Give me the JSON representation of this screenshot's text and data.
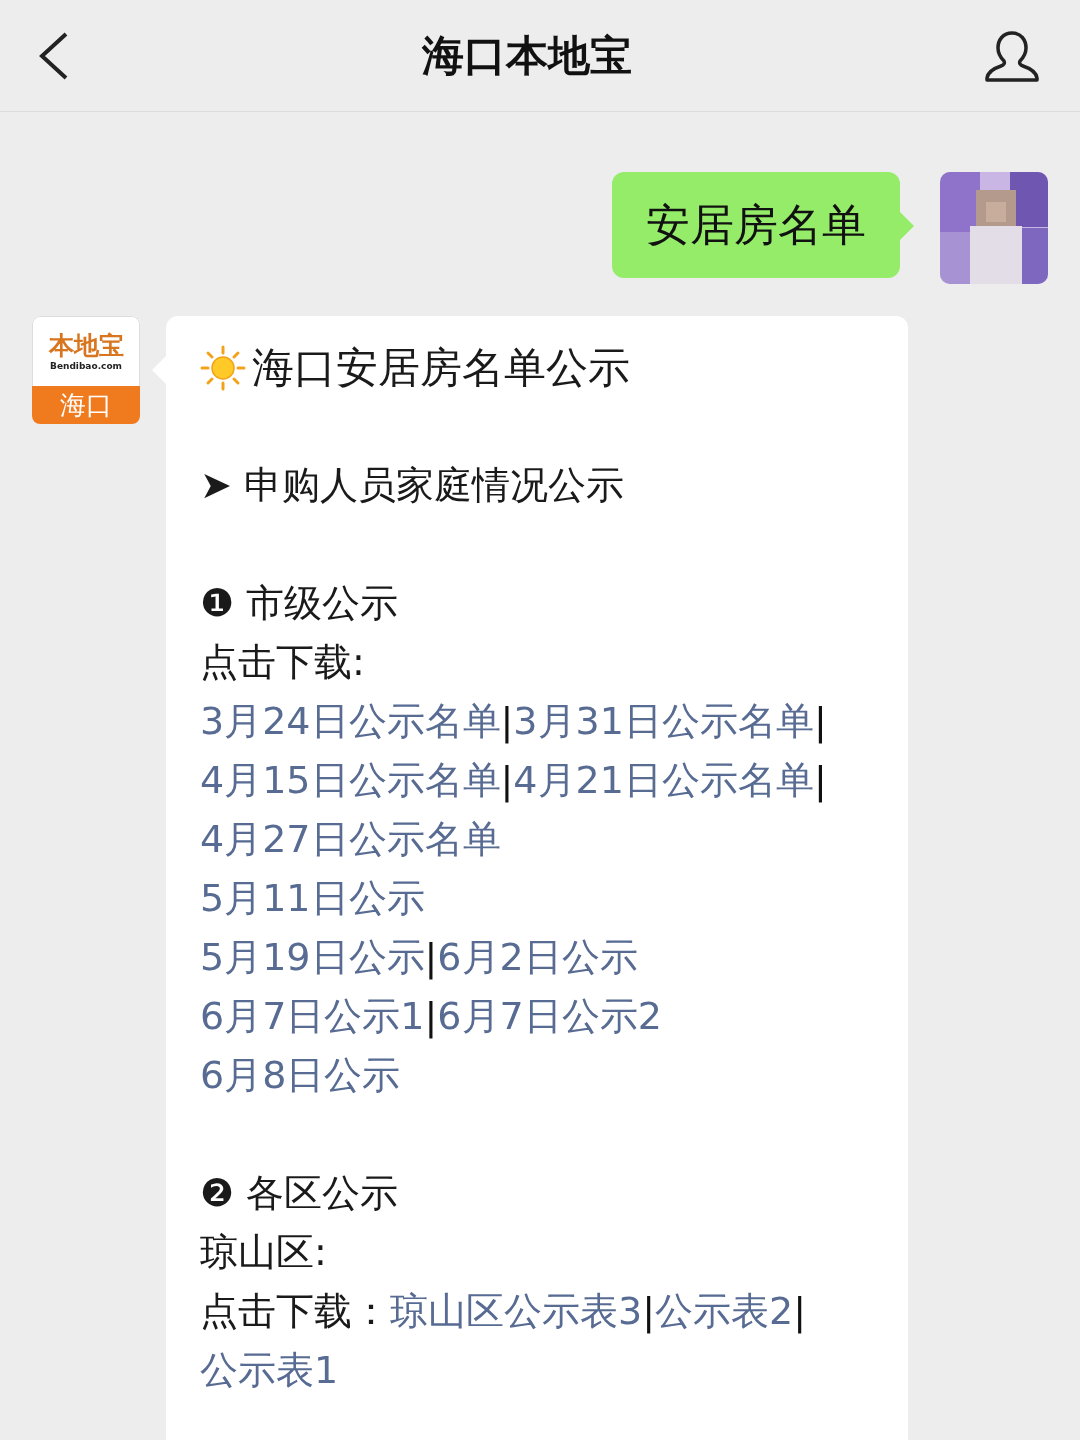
{
  "header": {
    "title": "海口本地宝"
  },
  "messages": [
    {
      "kind": "outgoing",
      "text": "安居房名单"
    },
    {
      "kind": "incoming",
      "logo": {
        "brand": "本地宝",
        "domain": "Bendibao.com",
        "city": "海口"
      },
      "blocks": [
        {
          "kind": "sun_title",
          "text": "海口安居房名单公示"
        },
        {
          "kind": "gap"
        },
        {
          "kind": "para",
          "segments": [
            {
              "kind": "text",
              "text": "➤ 申购人员家庭情况公示"
            }
          ]
        },
        {
          "kind": "gap"
        },
        {
          "kind": "para",
          "segments": [
            {
              "kind": "text",
              "text": "❶ 市级公示"
            }
          ]
        },
        {
          "kind": "para",
          "segments": [
            {
              "kind": "text",
              "text": "点击下载:"
            }
          ]
        },
        {
          "kind": "para",
          "segments": [
            {
              "kind": "link",
              "text": "3月24日公示名单"
            },
            {
              "kind": "sep",
              "text": "|"
            },
            {
              "kind": "link",
              "text": "3月31日公示名单"
            },
            {
              "kind": "sep",
              "text": "|"
            },
            {
              "kind": "link",
              "text": "4月15日公示名单"
            },
            {
              "kind": "sep",
              "text": "|"
            },
            {
              "kind": "link",
              "text": "4月21日公示名单"
            },
            {
              "kind": "sep",
              "text": "|"
            },
            {
              "kind": "link",
              "text": "4月27日公示名单"
            }
          ]
        },
        {
          "kind": "para",
          "segments": [
            {
              "kind": "link",
              "text": "5月11日公示"
            }
          ]
        },
        {
          "kind": "para",
          "segments": [
            {
              "kind": "link",
              "text": "5月19日公示"
            },
            {
              "kind": "sep",
              "text": "|"
            },
            {
              "kind": "link",
              "text": "6月2日公示"
            }
          ]
        },
        {
          "kind": "para",
          "segments": [
            {
              "kind": "link",
              "text": "6月7日公示1"
            },
            {
              "kind": "sep",
              "text": "|"
            },
            {
              "kind": "link",
              "text": "6月7日公示2"
            }
          ]
        },
        {
          "kind": "para",
          "segments": [
            {
              "kind": "link",
              "text": "6月8日公示"
            }
          ]
        },
        {
          "kind": "gap"
        },
        {
          "kind": "para",
          "segments": [
            {
              "kind": "text",
              "text": "❷ 各区公示"
            }
          ]
        },
        {
          "kind": "para",
          "segments": [
            {
              "kind": "text",
              "text": "琼山区:"
            }
          ]
        },
        {
          "kind": "para",
          "segments": [
            {
              "kind": "text",
              "text": "点击下载："
            },
            {
              "kind": "link",
              "text": "琼山区公示表3"
            },
            {
              "kind": "sep",
              "text": "|"
            },
            {
              "kind": "link",
              "text": "公示表2"
            },
            {
              "kind": "sep",
              "text": "|"
            },
            {
              "kind": "link",
              "text": "公示表1"
            }
          ]
        }
      ]
    }
  ]
}
